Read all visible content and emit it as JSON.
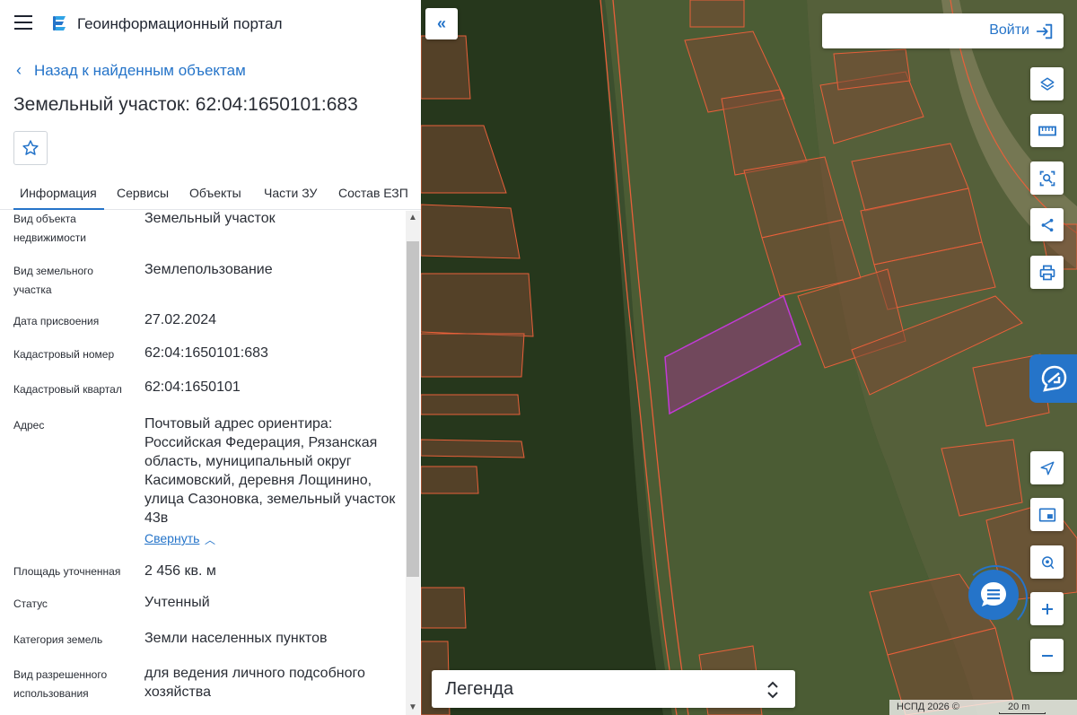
{
  "header": {
    "app_title": "Геоинформационный портал",
    "menu_icon": "menu-icon",
    "logo_icon": "portal-logo-icon"
  },
  "nav": {
    "back_label": "Назад к найденным объектам"
  },
  "object": {
    "title": "Земельный участок: 62:04:1650101:683",
    "favorite_icon": "star-icon"
  },
  "tabs": [
    {
      "label": "Информация",
      "active": true
    },
    {
      "label": "Сервисы",
      "active": false
    },
    {
      "label": "Объекты",
      "active": false
    },
    {
      "label": "Части ЗУ",
      "active": false
    },
    {
      "label": "Состав ЕЗП",
      "active": false
    }
  ],
  "info": {
    "fields": [
      {
        "label": "Вид объекта недвижимости",
        "value": "Земельный участок"
      },
      {
        "label": "Вид земельного участка",
        "value": "Землепользование"
      },
      {
        "label": "Дата присвоения",
        "value": "27.02.2024"
      },
      {
        "label": "Кадастровый номер",
        "value": "62:04:1650101:683"
      },
      {
        "label": "Кадастровый квартал",
        "value": "62:04:1650101"
      },
      {
        "label": "Адрес",
        "value": "Почтовый адрес ориентира: Российская Федерация, Рязанская область, муниципальный округ Касимовский, деревня Лощинино, улица Сазоновка, земельный участок 43в"
      },
      {
        "label": "Площадь уточненная",
        "value": "2 456 кв. м"
      },
      {
        "label": "Статус",
        "value": "Учтенный"
      },
      {
        "label": "Категория земель",
        "value": "Земли населенных пунктов"
      },
      {
        "label": "Вид разрешенного использования",
        "value": "для ведения личного подсобного хозяйства"
      }
    ],
    "collapse_label": "Свернуть"
  },
  "map": {
    "login_label": "Войти",
    "legend_label": "Легенда",
    "attribution": "НСПД 2026 ©",
    "scale_label": "20 m",
    "accent_color": "#2574c9",
    "parcel_border_color": "#e8603a",
    "selected_parcel_color": "#c23ad6",
    "tools": [
      "layers-icon",
      "ruler-icon",
      "select-area-icon",
      "share-icon",
      "print-icon",
      "locate-icon",
      "minimap-icon",
      "pin-search-icon",
      "zoom-in-icon",
      "zoom-out-icon"
    ]
  }
}
